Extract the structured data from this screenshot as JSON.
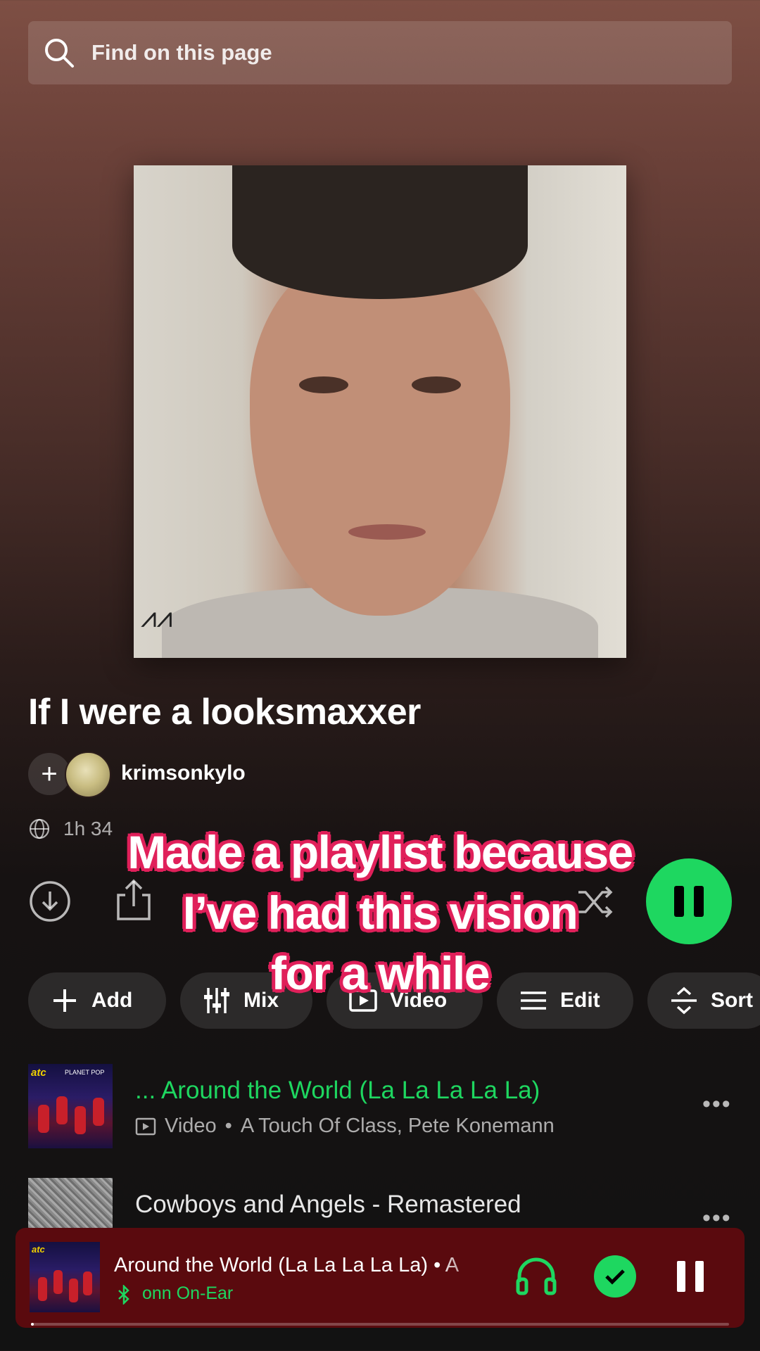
{
  "search": {
    "placeholder": "Find on this page",
    "icon": "search-icon"
  },
  "playlist": {
    "title": "If I were a looksmaxxer",
    "owner": "krimsonkylo",
    "duration": "1h 34"
  },
  "caption": {
    "lines": [
      "Made a playlist because",
      "I’ve had this vision",
      "for a while"
    ]
  },
  "chips": [
    {
      "label": "Add",
      "icon": "plus-icon"
    },
    {
      "label": "Mix",
      "icon": "sliders-icon"
    },
    {
      "label": "Video",
      "icon": "video-icon"
    },
    {
      "label": "Edit",
      "icon": "list-icon"
    },
    {
      "label": "Sort",
      "icon": "sort-icon"
    }
  ],
  "tracks": [
    {
      "title": "... Around the World (La La La La La)",
      "type": "Video",
      "artists": "A Touch Of Class, Pete Konemann",
      "playing": true,
      "art_logo": "atc",
      "art_sub": "PLANET POP"
    },
    {
      "title": "Cowboys and Angels - Remastered"
    }
  ],
  "now_playing": {
    "title": "Around the World (La La La La La) • A",
    "device": "onn On-Ear",
    "progress": 0.003,
    "art_logo": "atc"
  },
  "colors": {
    "accent": "#1ed760",
    "now_playing_bg": "#5a0a0e",
    "caption_outline": "#e0205a"
  },
  "bullet": "•"
}
